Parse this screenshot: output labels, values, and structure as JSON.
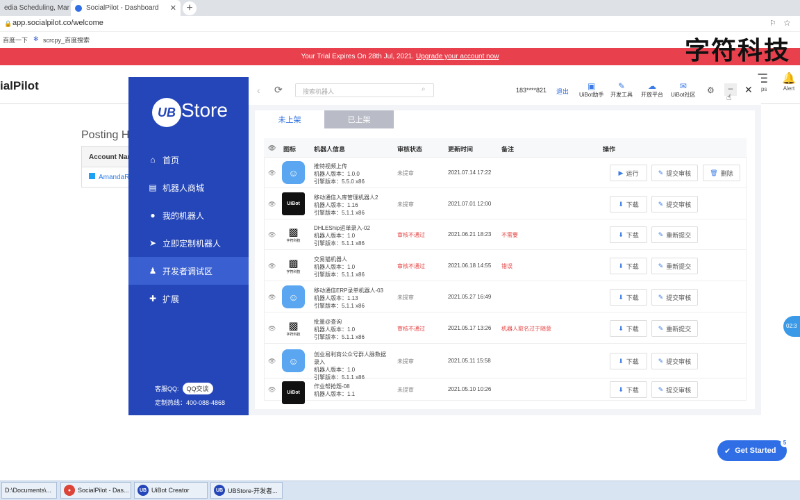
{
  "browser": {
    "tabs": [
      {
        "label": "edia Scheduling, Mark",
        "close": "✕"
      },
      {
        "label": "SocialPilot - Dashboard",
        "close": "✕"
      }
    ],
    "new_tab": "+",
    "url": "app.socialpilot.co/welcome",
    "bookmarks": [
      "百度一下",
      "scrcpy_百度搜索"
    ]
  },
  "banner": {
    "text": "Your Trial Expires On 28th Jul, 2021.",
    "link": "Upgrade your account now"
  },
  "socialpilot": {
    "title": "ialPilot",
    "posting": "Posting H",
    "account_header": "Account Nam",
    "account_value": "AmandaR",
    "icons": [
      {
        "label": ""
      },
      {
        "label": ""
      },
      {
        "label": ""
      },
      {
        "label": "pps"
      },
      {
        "label": "Alert"
      }
    ]
  },
  "watermark": "字符科技",
  "ubstore": {
    "logo_mark": "UB",
    "logo_text": "Store",
    "nav": [
      {
        "label": "首页",
        "icon": "home-icon"
      },
      {
        "label": "机器人商城",
        "icon": "store-icon"
      },
      {
        "label": "我的机器人",
        "icon": "robot-icon"
      },
      {
        "label": "立即定制机器人",
        "icon": "send-icon"
      },
      {
        "label": "开发者调试区",
        "icon": "developer-icon"
      },
      {
        "label": "扩展",
        "icon": "puzzle-icon"
      }
    ],
    "active_nav": 4,
    "service_label": "客服QQ:",
    "qq_button": "QQ交谈",
    "hotline": "定制热线：400-088-4868",
    "search_placeholder": "搜索机器人",
    "phone": "183****821",
    "logout": "退出",
    "tools": [
      {
        "label": "UiBot助手",
        "icon": "assistant-icon"
      },
      {
        "label": "开发工具",
        "icon": "pen-icon"
      },
      {
        "label": "开放平台",
        "icon": "cloud-icon"
      },
      {
        "label": "UiBot社区",
        "icon": "chat-icon"
      }
    ],
    "tabs": [
      "未上架",
      "已上架"
    ],
    "columns": [
      "图标",
      "机器人信息",
      "审核状态",
      "更新时间",
      "备注",
      "操作"
    ],
    "rows": [
      {
        "icon": "blue",
        "icon_text": "",
        "name": "推特视频上传",
        "version": "机器人版本：1.0.0",
        "engine": "引擎版本：5.5.0 x86",
        "status": "未提审",
        "status_color": "gray",
        "date": "2021.07.14 17:22",
        "note": "",
        "actions": [
          "运行",
          "提交审核",
          "删除"
        ]
      },
      {
        "icon": "black",
        "icon_text": "UiBot",
        "name": "移动通信入库管理机器人2",
        "version": "机器人版本：1.16",
        "engine": "引擎版本：5.1.1 x86",
        "status": "未提审",
        "status_color": "gray",
        "date": "2021.07.01 12:00",
        "note": "",
        "actions": [
          "下载",
          "提交审核"
        ]
      },
      {
        "icon": "qr",
        "icon_text": "字符科技",
        "name": "DHLEShip运单录入-02",
        "version": "机器人版本：1.0",
        "engine": "引擎版本：5.1.1 x86",
        "status": "审核不通过",
        "status_color": "red",
        "date": "2021.06.21 18:23",
        "note": "不需要",
        "actions": [
          "下载",
          "重新提交"
        ]
      },
      {
        "icon": "qr",
        "icon_text": "字符科技",
        "name": "交易猫机器人",
        "version": "机器人版本：1.0",
        "engine": "引擎版本：5.1.1 x86",
        "status": "审核不通过",
        "status_color": "red",
        "date": "2021.06.18 14:55",
        "note": "错误",
        "actions": [
          "下载",
          "重新提交"
        ]
      },
      {
        "icon": "blue",
        "icon_text": "",
        "name": "移动通信ERP录单机器人-03",
        "version": "机器人版本：1.13",
        "engine": "引擎版本：5.1.1 x86",
        "status": "未提审",
        "status_color": "gray",
        "date": "2021.05.27 16:49",
        "note": "",
        "actions": [
          "下载",
          "提交审核"
        ]
      },
      {
        "icon": "qr",
        "icon_text": "字符科技",
        "name": "批量@查询",
        "version": "机器人版本：1.0",
        "engine": "引擎版本：5.1.1 x86",
        "status": "审核不通过",
        "status_color": "red",
        "date": "2021.05.17 13:26",
        "note": "机器人取名过于随意",
        "actions": [
          "下载",
          "重新提交"
        ]
      },
      {
        "icon": "blue",
        "icon_text": "",
        "name": "创业易利商公众号群人脉数据录入",
        "version": "机器人版本：1.0",
        "engine": "引擎版本：5.1.1 x86",
        "status": "未提审",
        "status_color": "gray",
        "date": "2021.05.11 15:58",
        "note": "",
        "actions": [
          "下载",
          "提交审核"
        ]
      },
      {
        "icon": "black",
        "icon_text": "UiBot",
        "name": "作业帮抢题-08",
        "version": "机器人版本：1.1",
        "engine": "",
        "status": "未提审",
        "status_color": "gray",
        "date": "2021.05.10 10:26",
        "note": "",
        "actions": [
          "下载",
          "提交审核"
        ]
      }
    ]
  },
  "floating": {
    "get_started": "Get Started",
    "badge": "5",
    "clock": "02:3"
  },
  "taskbar": [
    {
      "label": "D:\\Documents\\...",
      "icon": "folder-icon"
    },
    {
      "label": "SocialPilot - Das...",
      "icon": "chrome-icon"
    },
    {
      "label": "UiBot Creator",
      "icon": "uibot-icon"
    },
    {
      "label": "UBStore-开发者...",
      "icon": "ubstore-icon"
    }
  ],
  "colors": {
    "banner": "#e8414d",
    "sidebar": "#2446b8",
    "accent": "#2c6fe0",
    "error": "#e54444"
  }
}
